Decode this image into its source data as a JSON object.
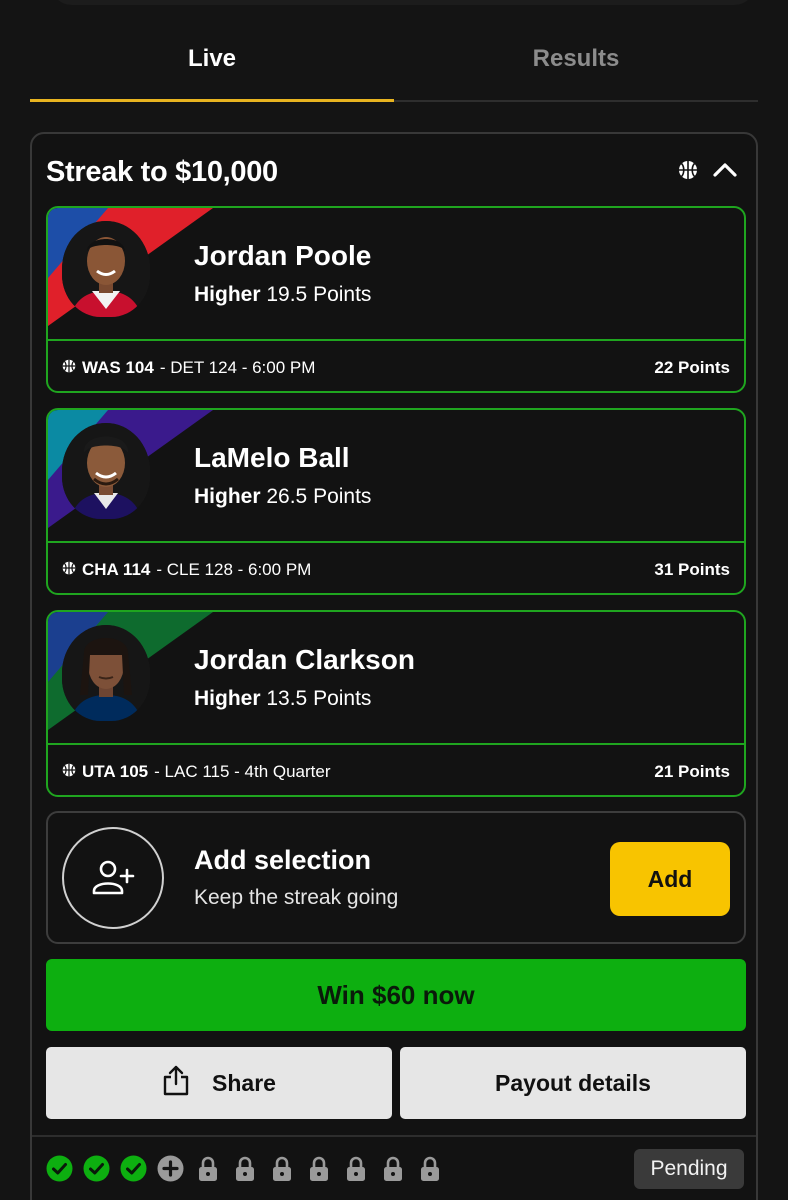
{
  "tabs": [
    {
      "label": "Live",
      "active": true
    },
    {
      "label": "Results",
      "active": false
    }
  ],
  "panel": {
    "title": "Streak to $10,000",
    "header_icons": [
      "basketball-icon",
      "chevron-up-icon"
    ]
  },
  "picks": [
    {
      "player": "Jordan Poole",
      "direction": "Higher",
      "line": "19.5 Points",
      "team_score": "WAS 104",
      "rest": "- DET 124 - 6:00 PM",
      "result": "22 Points",
      "stripe_colors": [
        "#1d4ea8",
        "#e0202a"
      ],
      "jersey_color": "#c8102e"
    },
    {
      "player": "LaMelo Ball",
      "direction": "Higher",
      "line": "26.5 Points",
      "team_score": "CHA 114",
      "rest": "- CLE 128 - 6:00 PM",
      "result": "31 Points",
      "stripe_colors": [
        "#0b8aa3",
        "#3a1a8c"
      ],
      "jersey_color": "#1d1160"
    },
    {
      "player": "Jordan Clarkson",
      "direction": "Higher",
      "line": "13.5 Points",
      "team_score": "UTA 105",
      "rest": "- LAC 115 - 4th Quarter",
      "result": "21 Points",
      "stripe_colors": [
        "#1b3f8f",
        "#0e6b2e"
      ],
      "jersey_color": "#002b5c"
    }
  ],
  "add_selection": {
    "title": "Add selection",
    "subtitle": "Keep the streak going",
    "button": "Add"
  },
  "win_button": "Win $60 now",
  "share_button": "Share",
  "payout_button": "Payout details",
  "progress": {
    "states": [
      "won",
      "won",
      "won",
      "add",
      "locked",
      "locked",
      "locked",
      "locked",
      "locked",
      "locked",
      "locked"
    ],
    "status": "Pending"
  },
  "colors": {
    "accent_yellow": "#f8c400",
    "win_green": "#0daf10",
    "pick_border": "#1fa51f",
    "tab_underline": "#e8b420"
  }
}
